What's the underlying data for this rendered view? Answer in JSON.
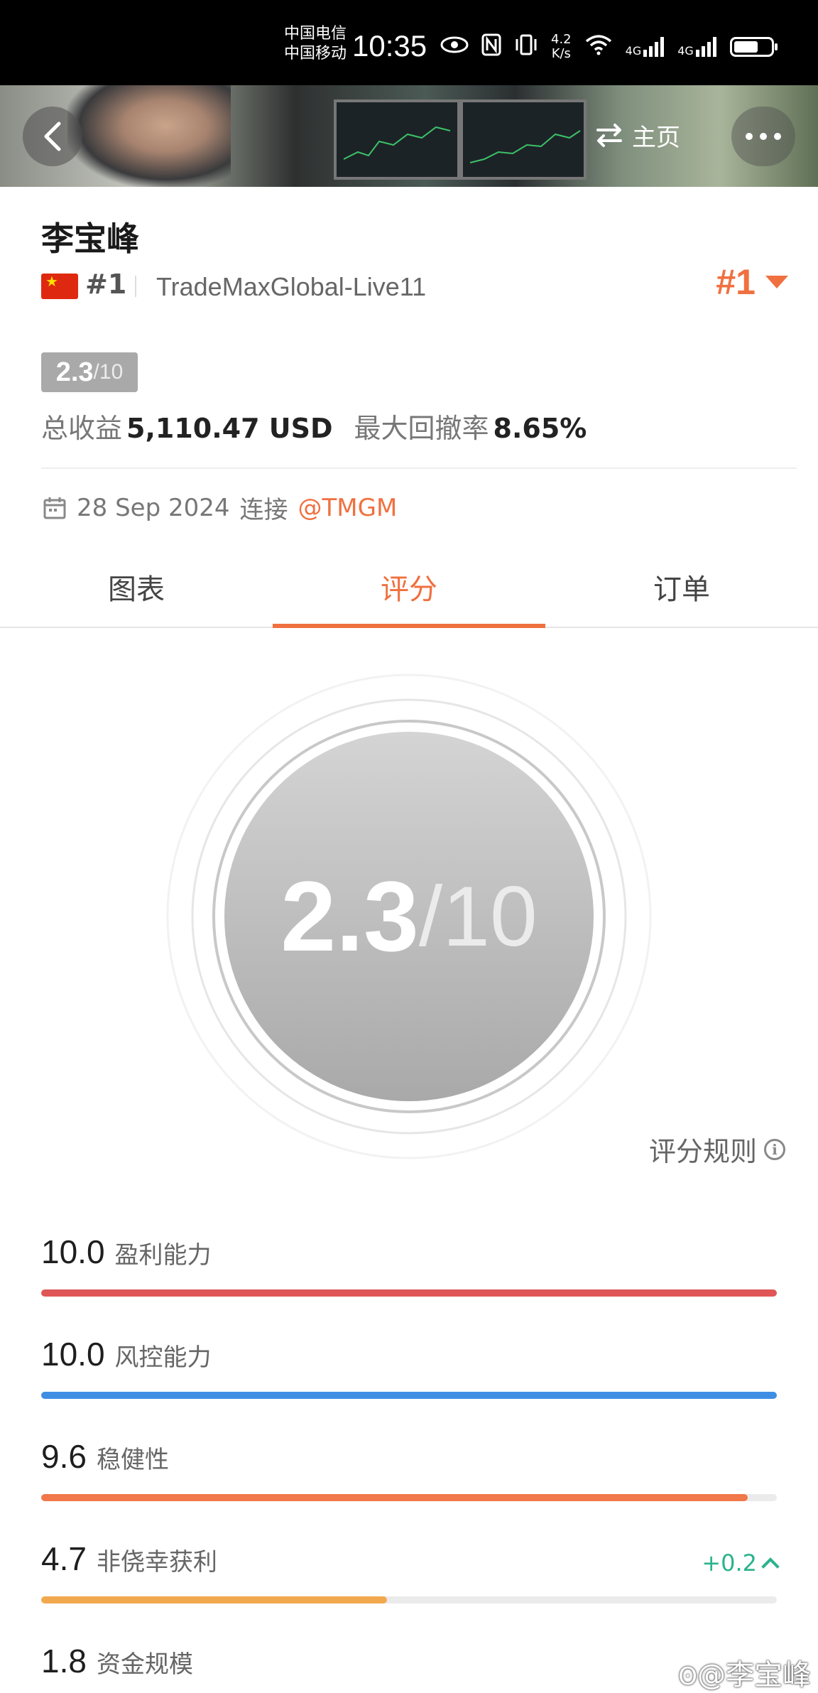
{
  "status_bar": {
    "carrier_1": "中国电信",
    "carrier_2": "中国移动",
    "time": "10:35",
    "net_speed_value": "4.2",
    "net_speed_unit": "K/s",
    "signal_1_label": "4G",
    "signal_2_label": "4G"
  },
  "header": {
    "home_label": "主页"
  },
  "profile": {
    "name": "李宝峰",
    "country_flag": "china-flag",
    "rank_small": "#1",
    "server": "TradeMaxGlobal-Live11",
    "rank_big": "#1",
    "score_main": "2.3",
    "score_sub": "/10",
    "total_profit_label": "总收益",
    "total_profit_value": "5,110.47 USD",
    "max_drawdown_label": "最大回撤率",
    "max_drawdown_value": "8.65%",
    "connect_date": "28 Sep 2024",
    "connect_label": "连接",
    "broker_link": "@TMGM"
  },
  "tabs": [
    {
      "label": "图表",
      "active": false
    },
    {
      "label": "评分",
      "active": true
    },
    {
      "label": "订单",
      "active": false
    }
  ],
  "score_circle": {
    "main": "2.3",
    "sub": "/10"
  },
  "rules_label": "评分规则",
  "metrics": [
    {
      "value": "10.0",
      "label": "盈利能力",
      "level": 1.0,
      "color": "#e05656"
    },
    {
      "value": "10.0",
      "label": "风控能力",
      "level": 1.0,
      "color": "#3f8ee3"
    },
    {
      "value": "9.6",
      "label": "稳健性",
      "level": 0.96,
      "color": "#f0784a"
    },
    {
      "value": "4.7",
      "label": "非侥幸获利",
      "level": 0.47,
      "color": "#f2a94e",
      "delta": "+0.2"
    },
    {
      "value": "1.8",
      "label": "资金规模",
      "level": 0.18,
      "color": "#f2a94e"
    }
  ],
  "watermark": "@李宝峰",
  "colors": {
    "accent": "#f0703f",
    "positive": "#2ab38d",
    "badge_gray": "#a9a9a9"
  }
}
